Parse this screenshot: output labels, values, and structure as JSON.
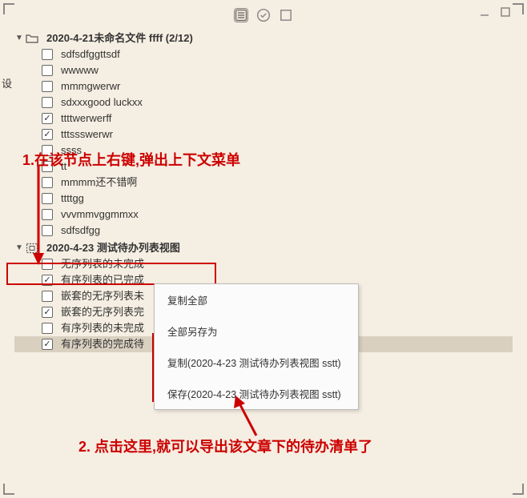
{
  "settings_side_label": "设",
  "toolbar": {
    "list_icon": "list",
    "check_icon": "check",
    "box_icon": "box"
  },
  "tree": {
    "folder1": {
      "label": "2020-4-21未命名文件 ffff (2/12)"
    },
    "items1": [
      {
        "label": "sdfsdfggttsdf",
        "checked": false
      },
      {
        "label": "wwwww",
        "checked": false
      },
      {
        "label": "mmmgwerwr",
        "checked": false
      },
      {
        "label": "sdxxxgood luckxx",
        "checked": false
      },
      {
        "label": "ttttwerwerff",
        "checked": true
      },
      {
        "label": "tttssswerwr",
        "checked": true
      },
      {
        "label": "ssss",
        "checked": false
      },
      {
        "label": "tt",
        "checked": false
      },
      {
        "label": "mmmm还不错啊",
        "checked": false
      },
      {
        "label": "ttttgg",
        "checked": false
      },
      {
        "label": "vvvmmvggmmxx",
        "checked": false
      },
      {
        "label": "sdfsdfgg",
        "checked": false
      }
    ],
    "folder2": {
      "label": "2020-4-23 测试待办列表视图"
    },
    "items2": [
      {
        "label": "无序列表的未完成",
        "checked": false
      },
      {
        "label": "有序列表的已完成",
        "checked": true
      },
      {
        "label": "嵌套的无序列表未",
        "checked": false
      },
      {
        "label": "嵌套的无序列表完",
        "checked": true
      },
      {
        "label": "有序列表的未完成",
        "checked": false
      },
      {
        "label": "有序列表的完成待",
        "checked": true
      }
    ]
  },
  "context_menu": {
    "copy_all": "复制全部",
    "save_all_as": "全部另存为",
    "copy_item": "复制(2020-4-23 测试待办列表视图 sstt)",
    "save_item": "保存(2020-4-23 测试待办列表视图 sstt)"
  },
  "annotations": {
    "step1": "1.在该节点上右键,弹出上下文菜单",
    "step2": "2. 点击这里,就可以导出该文章下的待办清单了"
  }
}
